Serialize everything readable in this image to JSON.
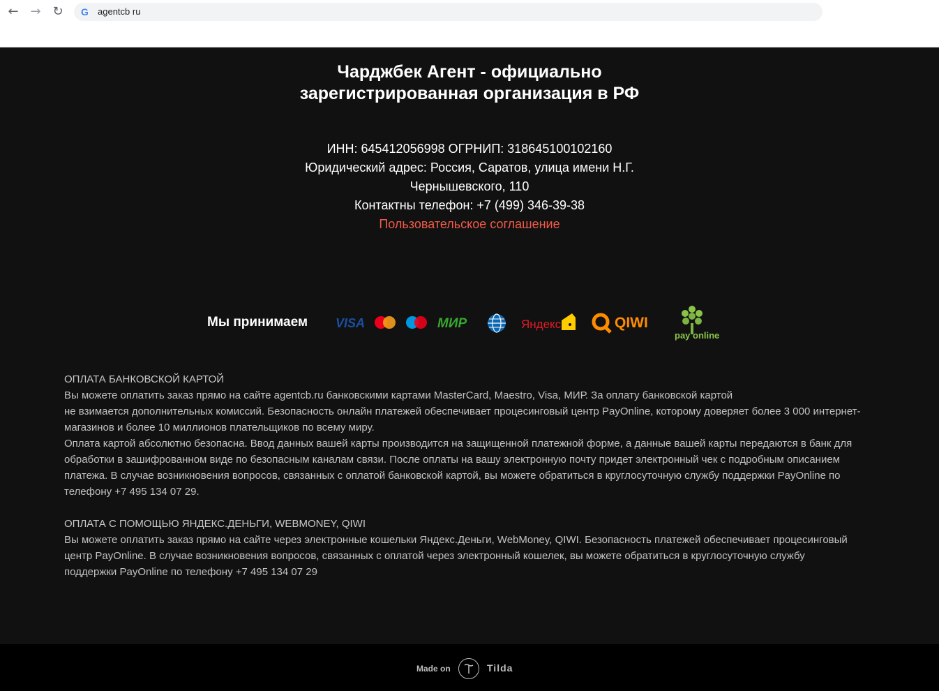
{
  "browser": {
    "url": "agentcb ru"
  },
  "header": {
    "title_line1": "Чарджбек Агент - официально",
    "title_line2": "зарегистрированная организация в РФ"
  },
  "info": {
    "line1": "ИНН: 645412056998 ОГРНИП: 318645100102160",
    "line2": "Юридический адрес: Россия, Саратов, улица имени Н.Г.",
    "line3": "Чернышевского, 110",
    "line4": "Контактны телефон: +7 (499) 346-39-38",
    "agreement_link": "Пользовательское соглашение"
  },
  "payments": {
    "label": "Мы принимаем",
    "visa": "VISA",
    "mir": "МИР",
    "yandex": "Яндекс",
    "qiwi": "QIWI",
    "payonline": "pay online"
  },
  "card_section": {
    "title": "ОПЛАТА БАНКОВСКОЙ КАРТОЙ",
    "l1": "Вы можете оплатить заказ прямо на сайте agentcb.ru банковскими картами MasterCard, Maestro, Visa, МИР. За оплату банковской картой",
    "l2": "не взимается дополнительных комиссий. Безопасность онлайн платежей обеспечивает процесинговый центр PayOnline, которому доверяет более 3 000 интернет-",
    "l3": "магазинов и более 10 миллионов плательщиков по всему миру.",
    "l4": "Оплата картой абсолютно безопасна. Ввод данных вашей карты производится на защищенной платежной форме, а данные вашей карты передаются в банк для",
    "l5": "обработки в зашифрованном виде по безопасным каналам связи. После оплаты на вашу электронную почту придет электронный чек с подробным описанием",
    "l6": "платежа. В случае возникновения вопросов, связанных с оплатой банковской картой, вы можете обратиться в круглосуточную службу поддержки PayOnline по",
    "l7": "телефону +7 495 134 07 29."
  },
  "wallet_section": {
    "title": "ОПЛАТА С ПОМОЩЬЮ ЯНДЕКС.ДЕНЬГИ, WEBMONEY, QIWI",
    "l1": "Вы можете оплатить заказ прямо на сайте через электронные кошельки Яндекс.Деньги, WebMoney, QIWI. Безопасность платежей обеспечивает процесинговый",
    "l2": "центр PayOnline. В случае возникновения вопросов, связанных с оплатой через электронный кошелек, вы можете обратиться в круглосуточную службу",
    "l3": "поддержки PayOnline по телефону +7 495 134 07 29"
  },
  "footer": {
    "made_on": "Made on",
    "brand": "Tilda"
  },
  "colors": {
    "background": "#111111",
    "link": "#f15b48",
    "footer": "#000000"
  },
  "icons": [
    "back-arrow-icon",
    "forward-arrow-icon",
    "reload-icon",
    "google-icon",
    "tilda-logo-icon"
  ]
}
